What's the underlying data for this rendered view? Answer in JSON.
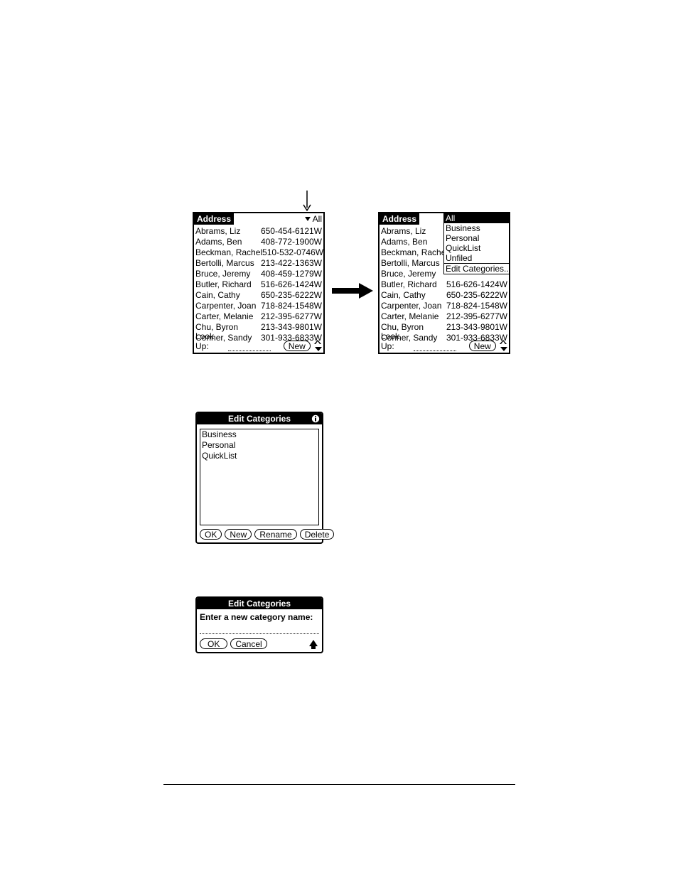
{
  "address_app": {
    "title": "Address",
    "category_selected": "All",
    "contacts": [
      {
        "name": "Abrams, Liz",
        "phone": "650-454-6121W"
      },
      {
        "name": "Adams, Ben",
        "phone": "408-772-1900W"
      },
      {
        "name": "Beckman, Rachel",
        "phone": "510-532-0746W"
      },
      {
        "name": "Bertolli, Marcus",
        "phone": "213-422-1363W"
      },
      {
        "name": "Bruce, Jeremy",
        "phone": "408-459-1279W"
      },
      {
        "name": "Butler, Richard",
        "phone": "516-626-1424W"
      },
      {
        "name": "Cain, Cathy",
        "phone": "650-235-6222W"
      },
      {
        "name": "Carpenter, Joan",
        "phone": "718-824-1548W"
      },
      {
        "name": "Carter, Melanie",
        "phone": "212-395-6277W"
      },
      {
        "name": "Chu, Byron",
        "phone": "213-343-9801W"
      },
      {
        "name": "Conner, Sandy",
        "phone": "301-933-6833W"
      }
    ],
    "lookup_label": "Look Up:",
    "new_button": "New"
  },
  "category_menu": {
    "items": [
      "All",
      "Business",
      "Personal",
      "QuickList",
      "Unfiled",
      "Edit Categories..."
    ],
    "selected_index": 0
  },
  "edit_categories": {
    "title": "Edit Categories",
    "items": [
      "Business",
      "Personal",
      "QuickList"
    ],
    "buttons": {
      "ok": "OK",
      "new": "New",
      "rename": "Rename",
      "delete": "Delete"
    }
  },
  "new_category_dialog": {
    "title": "Edit Categories",
    "prompt": "Enter a new category name:",
    "buttons": {
      "ok": "OK",
      "cancel": "Cancel"
    }
  }
}
